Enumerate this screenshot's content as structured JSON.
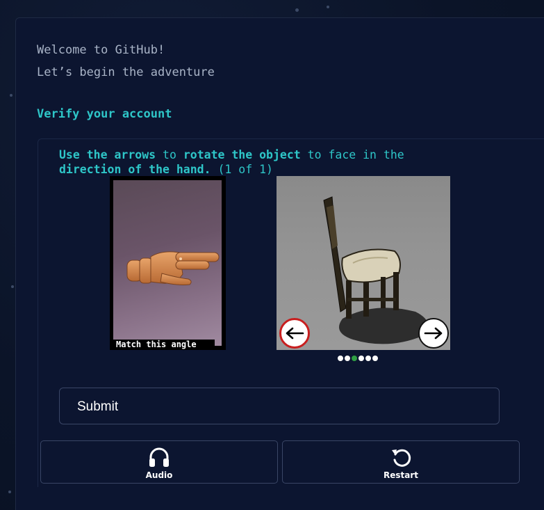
{
  "header": {
    "welcome_line1": "Welcome to GitHub!",
    "welcome_line2": "Let’s begin the adventure"
  },
  "verify": {
    "heading": "Verify your account"
  },
  "challenge": {
    "instr_part1": "Use the arrows",
    "instr_part2": " to ",
    "instr_part3": "rotate the object",
    "instr_part4": " to face in the ",
    "instr_part5": "direction of the hand.",
    "instr_part6": " (1 of 1)",
    "hand_caption": "Match this angle",
    "left_arrow_icon": "arrow-left-icon",
    "right_arrow_icon": "arrow-right-icon",
    "dots_total": 6,
    "dots_active_index": 2
  },
  "actions": {
    "submit_label": "Submit",
    "audio_label": "Audio",
    "restart_label": "Restart",
    "audio_icon": "headphones-icon",
    "restart_icon": "restart-icon"
  },
  "colors": {
    "accent": "#2ec6c8",
    "background": "#0c1530",
    "active_dot": "#2f9e44",
    "left_arrow_border": "#c81e1e"
  }
}
